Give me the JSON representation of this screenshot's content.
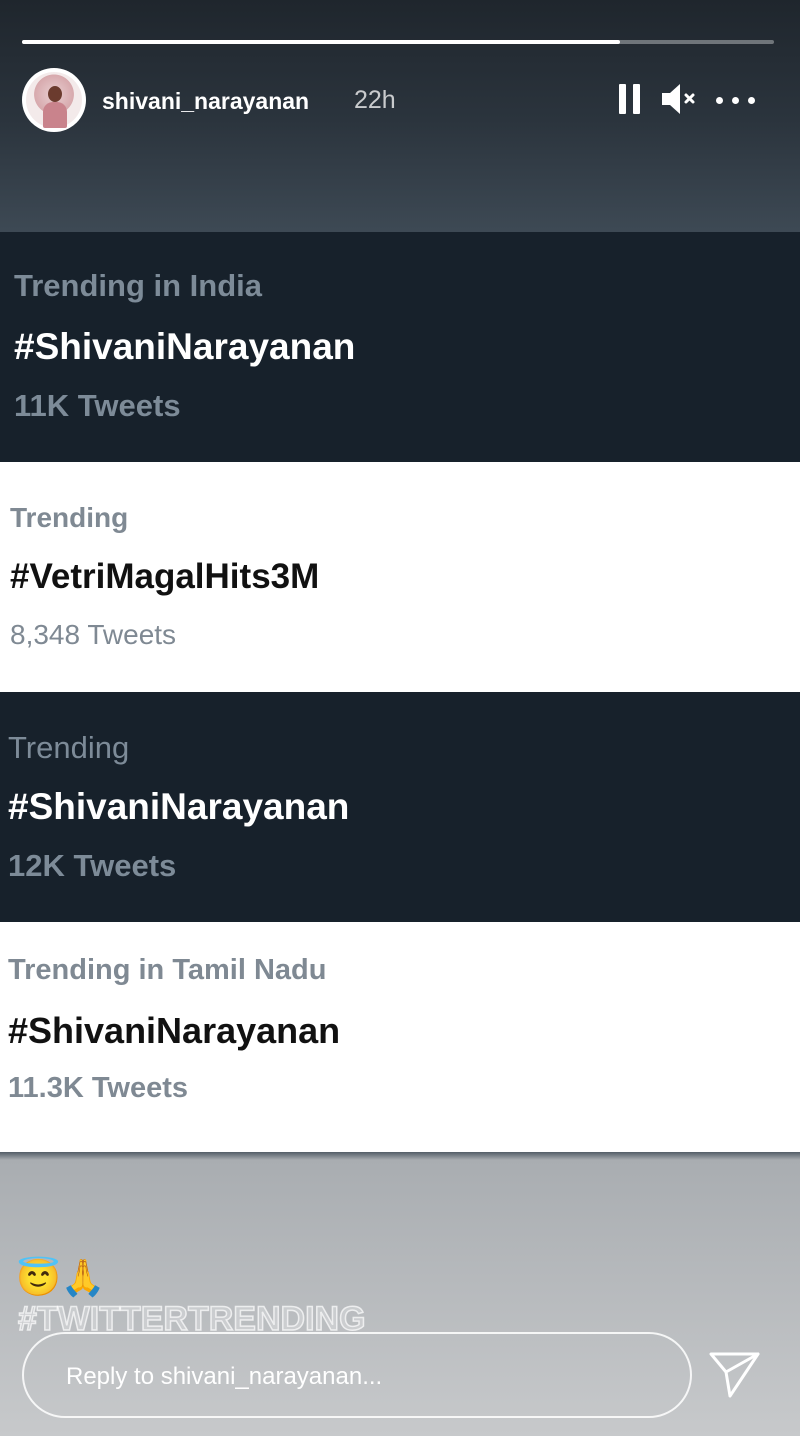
{
  "story": {
    "progress": 0.795,
    "user": "shivani_narayanan",
    "time": "22h",
    "icons": [
      "pause-icon",
      "mute-icon",
      "more-icon",
      "send-icon"
    ]
  },
  "trends": [
    {
      "category": "Trending in India",
      "hashtag": "#ShivaniNarayanan",
      "count": "11K Tweets",
      "theme": "dark"
    },
    {
      "category": "Trending",
      "hashtag": "#VetriMagalHits3M",
      "count": "8,348 Tweets",
      "theme": "light"
    },
    {
      "category": "Trending",
      "hashtag": "#ShivaniNarayanan",
      "count": "12K Tweets",
      "theme": "dark"
    },
    {
      "category": "Trending in Tamil Nadu",
      "hashtag": "#ShivaniNarayanan",
      "count": "11.3K Tweets",
      "theme": "light"
    }
  ],
  "caption": {
    "emoji": "😇🙏",
    "hashtag": "#TWITTERTRENDING"
  },
  "reply": {
    "placeholder": "Reply to shivani_narayanan..."
  },
  "colors": {
    "dark_card": "#17212b",
    "light_card": "#ffffff",
    "muted_text": "#7d8b98"
  }
}
